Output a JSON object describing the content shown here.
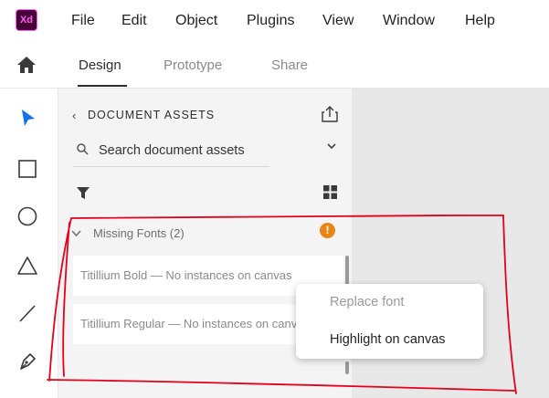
{
  "app": {
    "logo_text": "Xd"
  },
  "menu": [
    "File",
    "Edit",
    "Object",
    "Plugins",
    "View",
    "Window",
    "Help"
  ],
  "tabs": [
    "Design",
    "Prototype",
    "Share"
  ],
  "active_tab": "Design",
  "tools": [
    "select-tool",
    "rectangle-tool",
    "ellipse-tool",
    "triangle-tool",
    "line-tool",
    "pen-tool"
  ],
  "assets_panel": {
    "title": "DOCUMENT ASSETS",
    "search_placeholder": "Search document assets",
    "missing_fonts_label": "Missing Fonts (2)",
    "warning_glyph": "!",
    "fonts": [
      "Titillium Bold — No instances on canvas",
      "Titillium Regular — No instances on canvas"
    ]
  },
  "context_menu": {
    "items": [
      {
        "label": "Replace font",
        "enabled": false
      },
      {
        "label": "Highlight on canvas",
        "enabled": true
      }
    ]
  },
  "colors": {
    "accent": "#1473e6",
    "warning": "#e68619",
    "annotation": "#e3001b",
    "logo_bg": "#470137",
    "logo_fg": "#ff61f6"
  }
}
